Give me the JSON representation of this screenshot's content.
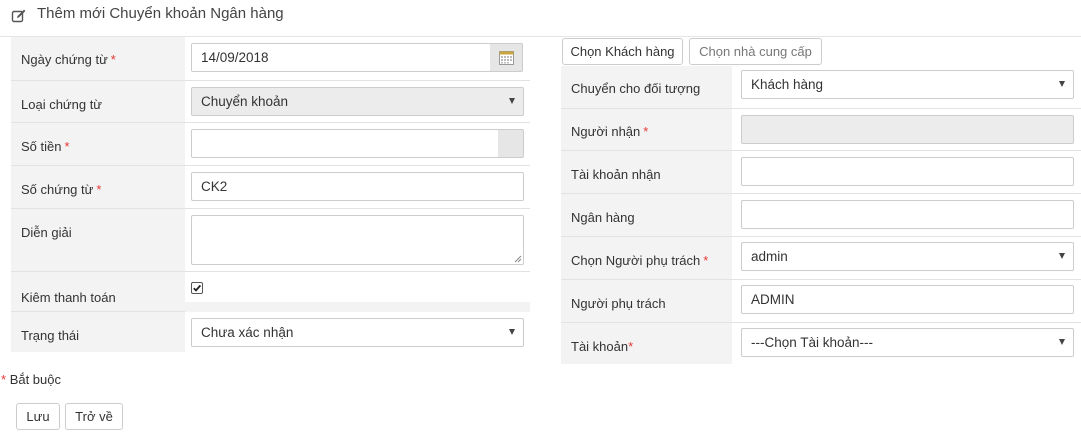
{
  "page": {
    "title": "Thêm mới Chuyển khoản Ngân hàng",
    "title_icon": "edit-icon"
  },
  "left_form": {
    "date_label": "Ngày chứng từ",
    "date_value": "14/09/2018",
    "doc_type_label": "Loại chứng từ",
    "doc_type_value": "Chuyển khoản",
    "amount_label": "Số tiền",
    "amount_value": "",
    "doc_no_label": "Số chứng từ",
    "doc_no_value": "CK2",
    "description_label": "Diễn giải",
    "description_value": "",
    "checkpay_label": "Kiêm thanh toán",
    "checkpay_checked": true,
    "status_label": "Trạng thái",
    "status_value": "Chưa xác nhận"
  },
  "right_form": {
    "tab_customer": "Chọn Khách hàng",
    "tab_supplier": "Chọn nhà cung cấp",
    "target_label": "Chuyển cho đối tượng",
    "target_value": "Khách hàng",
    "recipient_label": "Người nhận",
    "recipient_value": "",
    "recv_account_label": "Tài khoản nhận",
    "recv_account_value": "",
    "bank_label": "Ngân hàng",
    "bank_value": "",
    "choose_person_label": "Chọn Người phụ trách",
    "choose_person_value": "admin",
    "person_label": "Người phụ trách",
    "person_value": "ADMIN",
    "account_label": "Tài khoản",
    "account_value": "---Chọn Tài khoản---"
  },
  "required_marker": "*",
  "footnote": {
    "marker": "*",
    "text": "Bắt buộc"
  },
  "actions": {
    "save_label": "Lưu",
    "back_label": "Trở về"
  },
  "colors": {
    "required": "#e53935",
    "label_bg": "#f3f3f3",
    "border": "#cccccc",
    "disabled_bg": "#ececec"
  }
}
